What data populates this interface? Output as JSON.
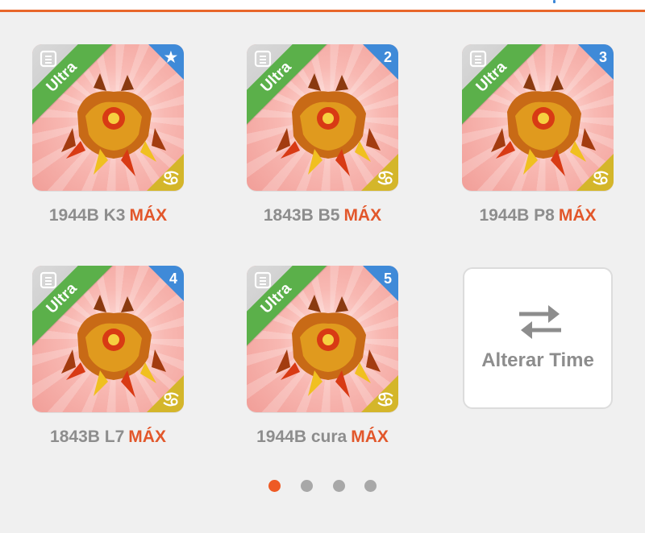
{
  "monsters": [
    {
      "name": "1944B K3",
      "level": "MÁX",
      "rarity": "Ultra",
      "rank": "★"
    },
    {
      "name": "1843B B5",
      "level": "MÁX",
      "rarity": "Ultra",
      "rank": "2"
    },
    {
      "name": "1944B P8",
      "level": "MÁX",
      "rarity": "Ultra",
      "rank": "3"
    },
    {
      "name": "1843B L7",
      "level": "MÁX",
      "rarity": "Ultra",
      "rank": "4"
    },
    {
      "name": "1944B cura",
      "level": "MÁX",
      "rarity": "Ultra",
      "rank": "5"
    }
  ],
  "switch_team": {
    "label": "Alterar Time",
    "icon": "swap-arrows-icon"
  },
  "pagination": {
    "total": 4,
    "active": 1
  },
  "colors": {
    "accent": "#e8662a",
    "max": "#e2572b",
    "ribbon": "#5bb04a",
    "rank": "#3f8ad8",
    "zodiac": "#d4b62a"
  }
}
